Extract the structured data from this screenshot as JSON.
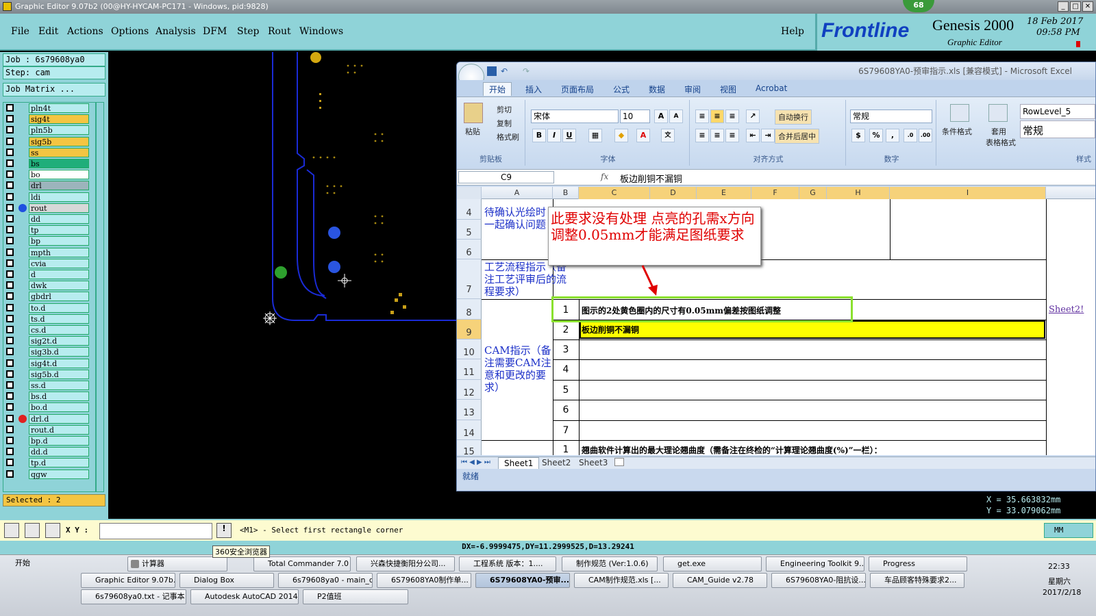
{
  "window": {
    "title": "Graphic Editor 9.07b2 (00@HY-HYCAM-PC171 - Windows, pid:9828)"
  },
  "menu": [
    "File",
    "Edit",
    "Actions",
    "Options",
    "Analysis",
    "DFM",
    "Step",
    "Rout",
    "Windows"
  ],
  "help_label": "Help",
  "brand": {
    "badge": "68",
    "logo": "Frontline",
    "product": "Genesis 2000",
    "subtitle": "Graphic Editor",
    "date": "18 Feb 2017",
    "time": "09:58 PM"
  },
  "job": {
    "job_line": "Job : 6s79608ya0",
    "step_line": "Step: cam",
    "matrix_button": "Job Matrix ..."
  },
  "layers": [
    {
      "name": "pln4t",
      "color": "#b7ecef"
    },
    {
      "name": "sig4t",
      "color": "#f4c542"
    },
    {
      "name": "pln5b",
      "color": "#b7ecef"
    },
    {
      "name": "sig5b",
      "color": "#f4c542"
    },
    {
      "name": "ss",
      "color": "#f4c542"
    },
    {
      "name": "bs",
      "color": "#1fae7a"
    },
    {
      "name": "bo",
      "color": "#ffffff"
    },
    {
      "name": "drl",
      "color": "#9cb4bc"
    },
    {
      "name": "ldi",
      "color": "#b7ecef"
    },
    {
      "name": "rout",
      "color": "#d8d8d8"
    },
    {
      "name": "dd",
      "color": "#b7ecef"
    },
    {
      "name": "tp",
      "color": "#b7ecef"
    },
    {
      "name": "bp",
      "color": "#b7ecef"
    },
    {
      "name": "mpth",
      "color": "#b7ecef"
    },
    {
      "name": "cvia",
      "color": "#b7ecef"
    },
    {
      "name": "d",
      "color": "#b7ecef"
    },
    {
      "name": "dwk",
      "color": "#b7ecef"
    },
    {
      "name": "gbdrl",
      "color": "#b7ecef"
    },
    {
      "name": "to.d",
      "color": "#b7ecef"
    },
    {
      "name": "ts.d",
      "color": "#b7ecef"
    },
    {
      "name": "cs.d",
      "color": "#b7ecef"
    },
    {
      "name": "sig2t.d",
      "color": "#b7ecef"
    },
    {
      "name": "sig3b.d",
      "color": "#b7ecef"
    },
    {
      "name": "sig4t.d",
      "color": "#b7ecef"
    },
    {
      "name": "sig5b.d",
      "color": "#b7ecef"
    },
    {
      "name": "ss.d",
      "color": "#b7ecef"
    },
    {
      "name": "bs.d",
      "color": "#b7ecef"
    },
    {
      "name": "bo.d",
      "color": "#b7ecef"
    },
    {
      "name": "drl.d",
      "color": "#b7ecef"
    },
    {
      "name": "rout.d",
      "color": "#b7ecef"
    },
    {
      "name": "bp.d",
      "color": "#b7ecef"
    },
    {
      "name": "dd.d",
      "color": "#b7ecef"
    },
    {
      "name": "tp.d",
      "color": "#b7ecef"
    },
    {
      "name": "qgw",
      "color": "#b7ecef"
    }
  ],
  "selected_label": "Selected : 2",
  "coords": {
    "x": "X = 35.663832mm",
    "y": "Y = 33.079062mm"
  },
  "command": {
    "xy_label": "X Y :",
    "prompt": "<M1> - Select first rectangle corner",
    "units": "MM"
  },
  "status_line": "DX=-6.9999475,DY=11.2999525,D=13.29241",
  "excel": {
    "title": "6S79608YA0-预审指示.xls [兼容模式] - Microsoft Excel",
    "tabs": [
      "开始",
      "插入",
      "页面布局",
      "公式",
      "数据",
      "审阅",
      "视图",
      "Acrobat"
    ],
    "clipboard": {
      "paste": "粘贴",
      "cut": "剪切",
      "copy": "复制",
      "format_painter": "格式刷",
      "label": "剪贴板"
    },
    "font": {
      "name": "宋体",
      "size": "10",
      "label": "字体"
    },
    "alignment": {
      "wrap": "自动换行",
      "merge": "合并后居中",
      "label": "对齐方式"
    },
    "number": {
      "format": "常规",
      "label": "数字"
    },
    "styles": {
      "cond": "条件格式",
      "table": "套用",
      "table2": "表格格式",
      "style1": "RowLevel_5",
      "style2": "常规",
      "label": "样式"
    },
    "name_box": "C9",
    "fx": "fx",
    "formula": "板边削铜不漏铜",
    "columns": [
      "A",
      "B",
      "C",
      "D",
      "E",
      "F",
      "G",
      "H",
      "I"
    ],
    "rows": [
      "4",
      "5",
      "6",
      "7",
      "8",
      "9",
      "10",
      "11",
      "12",
      "13",
      "14",
      "15"
    ],
    "cellA4": "待确认光绘时一起确认问题",
    "cellA7": "工艺流程指示（备注工艺评审后的流程要求）",
    "cellA10": "CAM指示（备注需要CAM注意和更改的要求）",
    "b_numbers": [
      "1",
      "2",
      "3",
      "4",
      "5",
      "6",
      "7",
      "1"
    ],
    "c8": "图示的2处黄色圈内的尺寸有0.05mm偏差按图纸调整",
    "c9": "板边削铜不漏铜",
    "c15": "翘曲软件计算出的最大理论翘曲度（需备注在终检的“计算理论翘曲度(%)”一栏）：",
    "j8": "Sheet2!",
    "sheets": [
      "Sheet1",
      "Sheet2",
      "Sheet3"
    ],
    "status": "就绪"
  },
  "annotation": "此要求没有处理  点亮的孔需x方向调整0.05mm才能满足图纸要求",
  "taskbar": {
    "start": "开始",
    "row1": [
      "计算器",
      "Total Commander 7.0 ...",
      "兴森快捷衡阳分公司...",
      "工程系统 版本：1....",
      "制作规范 (Ver:1.0.6)",
      "get.exe",
      "Engineering Toolkit 9....",
      "Progress"
    ],
    "row2": [
      "Graphic Editor 9.07b...",
      "Dialog Box",
      "6s79608ya0 - main_qa",
      "6S79608YA0制作单...",
      "6S79608YA0-预审...",
      "CAM制作规范.xls [...",
      "CAM_Guide v2.78",
      "6S79608YA0-阻抗设...",
      "车品顾客特殊要求2..."
    ],
    "row3": [
      "6s79608ya0.txt - 记事本",
      "Autodesk AutoCAD 2014...",
      "P2值班"
    ],
    "tooltip": "360安全浏览器",
    "clock": "22:33",
    "weekday": "星期六",
    "date": "2017/2/18"
  }
}
